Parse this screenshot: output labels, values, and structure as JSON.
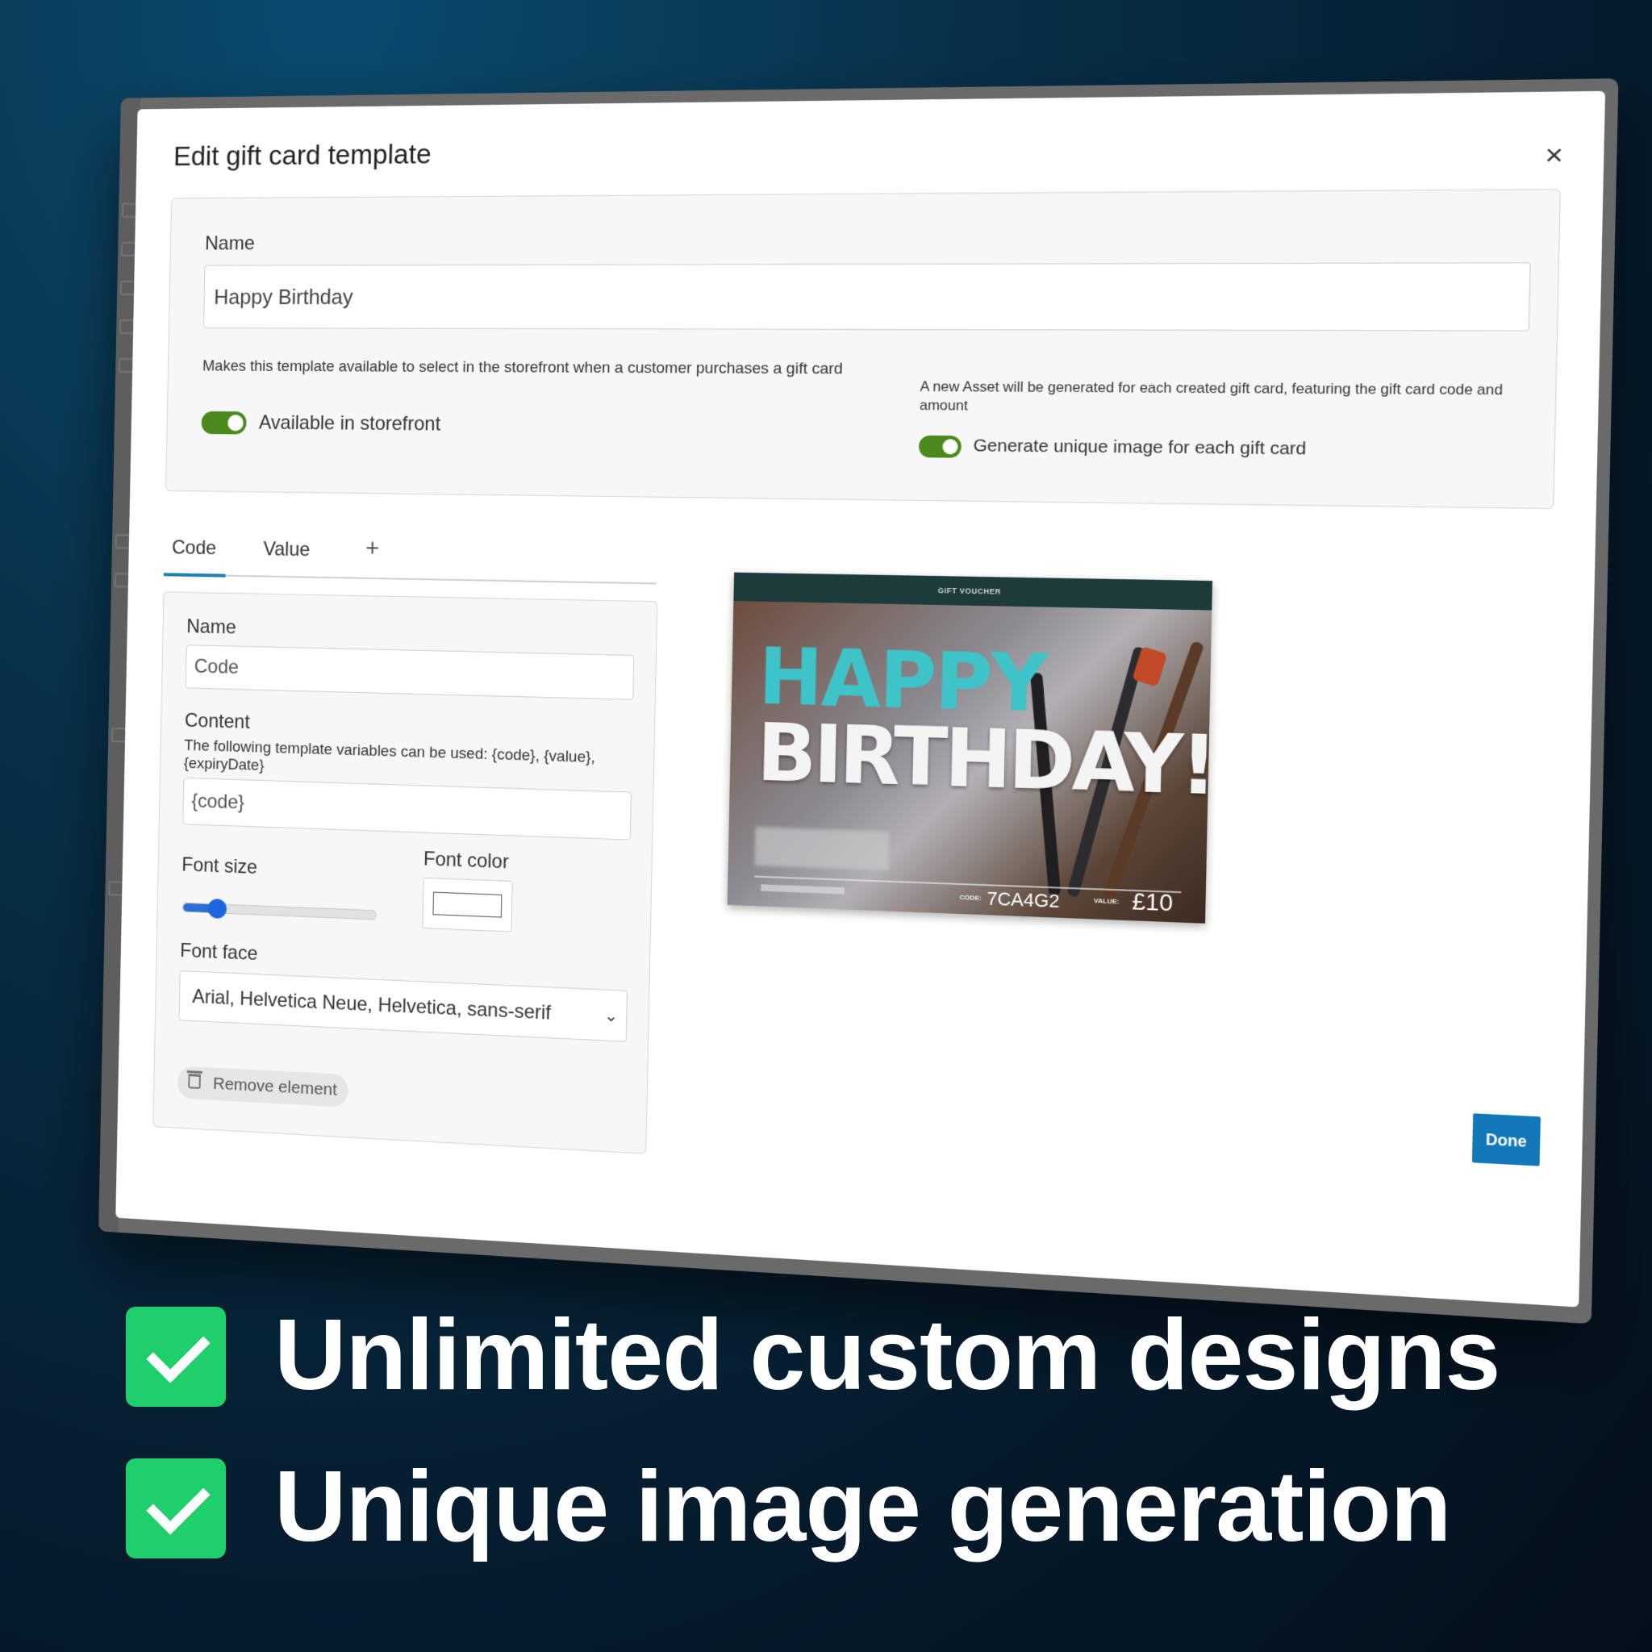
{
  "modal": {
    "title": "Edit gift card template",
    "close_label": "×",
    "done_label": "Done"
  },
  "template": {
    "name_label": "Name",
    "name_value": "Happy Birthday",
    "storefront_help": "Makes this template available to select in the storefront when a customer purchases a gift card",
    "storefront_toggle_label": "Available in storefront",
    "storefront_toggle_on": true,
    "image_help": "A new Asset will be generated for each created gift card, featuring the gift card code and amount",
    "image_toggle_label": "Generate unique image for each gift card",
    "image_toggle_on": true
  },
  "tabs": [
    {
      "label": "Code",
      "active": true
    },
    {
      "label": "Value",
      "active": false
    }
  ],
  "add_tab_label": "+",
  "element": {
    "name_label": "Name",
    "name_value": "Code",
    "content_label": "Content",
    "content_help": "The following template variables can be used: {code}, {value}, {expiryDate}",
    "content_value": "{code}",
    "font_size_label": "Font size",
    "font_size_fraction": 0.18,
    "font_color_label": "Font color",
    "font_color_value": "#ffffff",
    "font_face_label": "Font face",
    "font_face_value": "Arial, Helvetica Neue, Helvetica, sans-serif",
    "remove_label": "Remove element"
  },
  "voucher": {
    "header": "GIFT VOUCHER",
    "line1": "HAPPY",
    "line2": "BIRTHDAY!",
    "code_label": "CODE:",
    "code": "7CA4G2",
    "value_label": "VALUE:",
    "value": "£10"
  },
  "bullets": [
    {
      "text": "Unlimited custom designs"
    },
    {
      "text": "Unique image generation"
    }
  ],
  "colors": {
    "background": "#062236",
    "check_green": "#1fcf6b",
    "toggle_green": "#4a8a1c",
    "tab_accent": "#1c7fb6",
    "done_blue": "#1278b8"
  }
}
